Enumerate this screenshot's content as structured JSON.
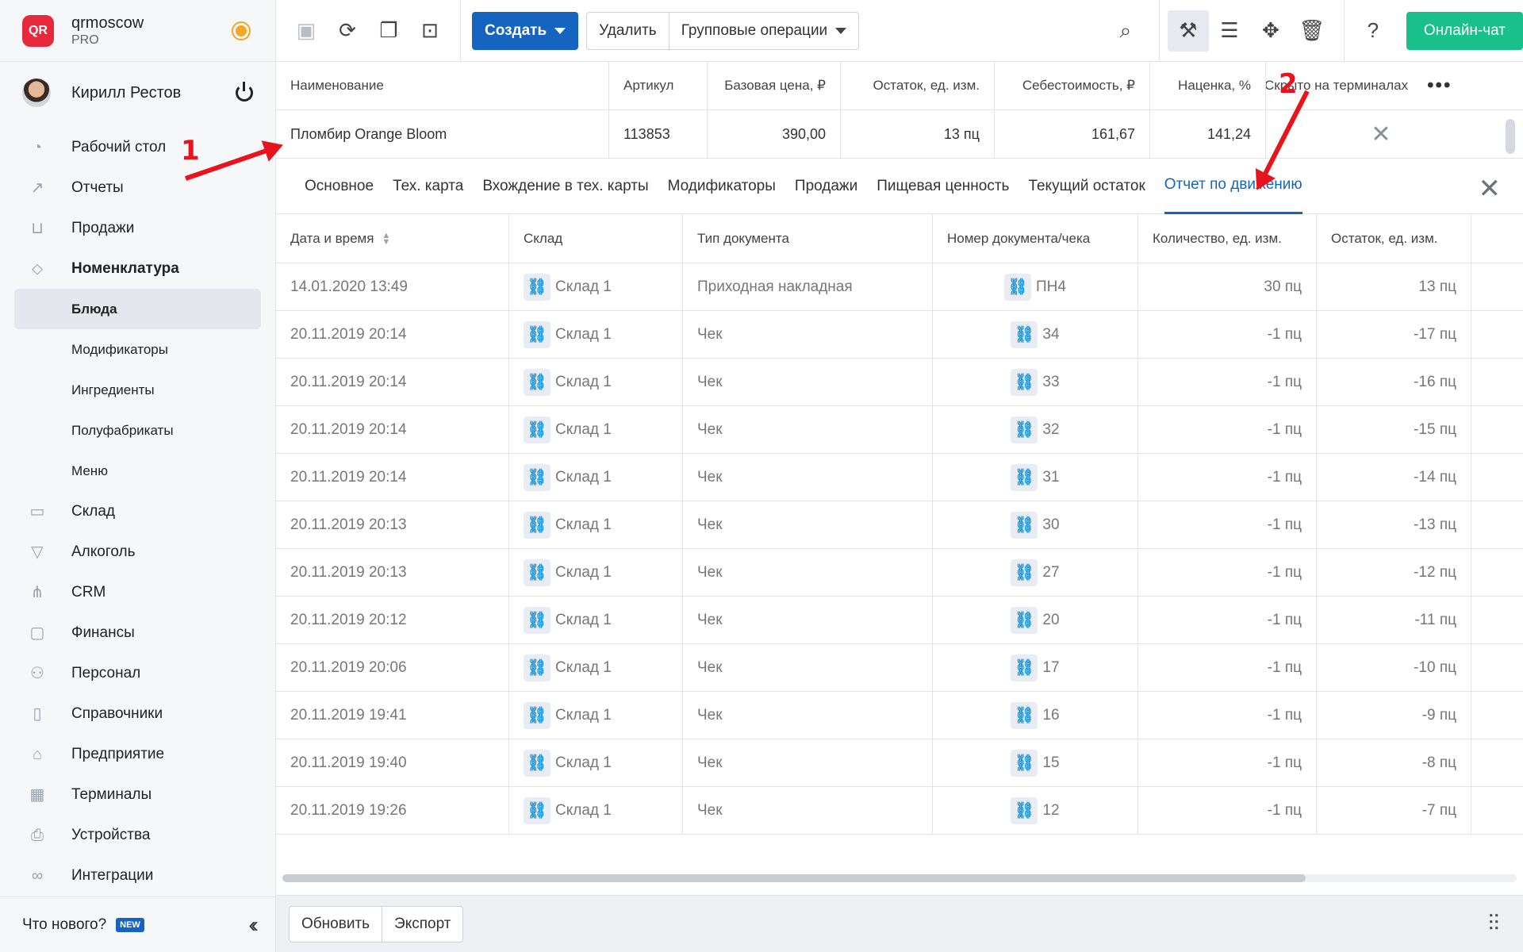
{
  "brand": {
    "name": "qrmoscow",
    "plan": "PRO",
    "logo": "QR"
  },
  "user": {
    "name": "Кирилл Рестов"
  },
  "nav": [
    {
      "label": "Рабочий стол",
      "icon": "gauge-icon"
    },
    {
      "label": "Отчеты",
      "icon": "chart-icon"
    },
    {
      "label": "Продажи",
      "icon": "basket-icon"
    },
    {
      "label": "Номенклатура",
      "icon": "tag-icon"
    }
  ],
  "subnav": [
    "Блюда",
    "Модификаторы",
    "Ингредиенты",
    "Полуфабрикаты",
    "Меню"
  ],
  "nav2": [
    {
      "label": "Склад",
      "icon": "box-icon"
    },
    {
      "label": "Алкоголь",
      "icon": "glass-icon"
    },
    {
      "label": "CRM",
      "icon": "hierarchy-icon"
    },
    {
      "label": "Финансы",
      "icon": "wallet-icon"
    },
    {
      "label": "Персонал",
      "icon": "people-icon"
    },
    {
      "label": "Справочники",
      "icon": "book-icon"
    },
    {
      "label": "Предприятие",
      "icon": "store-icon"
    },
    {
      "label": "Терминалы",
      "icon": "terminal-icon"
    },
    {
      "label": "Устройства",
      "icon": "printer-icon"
    },
    {
      "label": "Интеграции",
      "icon": "infinity-icon"
    }
  ],
  "footer": {
    "whats_new": "Что нового?",
    "badge": "NEW"
  },
  "toolbar": {
    "create": "Создать",
    "delete": "Удалить",
    "group_ops": "Групповые операции",
    "chat": "Онлайн-чат"
  },
  "product_table": {
    "headers": [
      "Наименование",
      "Артикул",
      "Базовая цена, ₽",
      "Остаток, ед. изм.",
      "Себестоимость, ₽",
      "Наценка, %",
      "Скрыто на терминалах"
    ],
    "row": [
      "Пломбир Orange Bloom",
      "113853",
      "390,00",
      "13 пц",
      "161,67",
      "141,24"
    ]
  },
  "tabs": [
    "Основное",
    "Тех. карта",
    "Вхождение в тех. карты",
    "Модификаторы",
    "Продажи",
    "Пищевая ценность",
    "Текущий остаток",
    "Отчет по движению"
  ],
  "movement": {
    "headers": [
      "Дата и время",
      "Склад",
      "Тип документа",
      "Номер документа/чека",
      "Количество, ед. изм.",
      "Остаток, ед. изм."
    ],
    "rows": [
      [
        "14.01.2020 13:49",
        "Склад 1",
        "Приходная накладная",
        "ПН4",
        "30 пц",
        "13 пц"
      ],
      [
        "20.11.2019 20:14",
        "Склад 1",
        "Чек",
        "34",
        "-1 пц",
        "-17 пц"
      ],
      [
        "20.11.2019 20:14",
        "Склад 1",
        "Чек",
        "33",
        "-1 пц",
        "-16 пц"
      ],
      [
        "20.11.2019 20:14",
        "Склад 1",
        "Чек",
        "32",
        "-1 пц",
        "-15 пц"
      ],
      [
        "20.11.2019 20:14",
        "Склад 1",
        "Чек",
        "31",
        "-1 пц",
        "-14 пц"
      ],
      [
        "20.11.2019 20:13",
        "Склад 1",
        "Чек",
        "30",
        "-1 пц",
        "-13 пц"
      ],
      [
        "20.11.2019 20:13",
        "Склад 1",
        "Чек",
        "27",
        "-1 пц",
        "-12 пц"
      ],
      [
        "20.11.2019 20:12",
        "Склад 1",
        "Чек",
        "20",
        "-1 пц",
        "-11 пц"
      ],
      [
        "20.11.2019 20:06",
        "Склад 1",
        "Чек",
        "17",
        "-1 пц",
        "-10 пц"
      ],
      [
        "20.11.2019 19:41",
        "Склад 1",
        "Чек",
        "16",
        "-1 пц",
        "-9 пц"
      ],
      [
        "20.11.2019 19:40",
        "Склад 1",
        "Чек",
        "15",
        "-1 пц",
        "-8 пц"
      ],
      [
        "20.11.2019 19:26",
        "Склад 1",
        "Чек",
        "12",
        "-1 пц",
        "-7 пц"
      ]
    ]
  },
  "bottom": {
    "refresh": "Обновить",
    "export": "Экспорт"
  },
  "annotations": [
    "1",
    "2"
  ],
  "colors": {
    "accent": "#1565c0",
    "chat": "#19c08a",
    "annotation": "#e8141c"
  }
}
